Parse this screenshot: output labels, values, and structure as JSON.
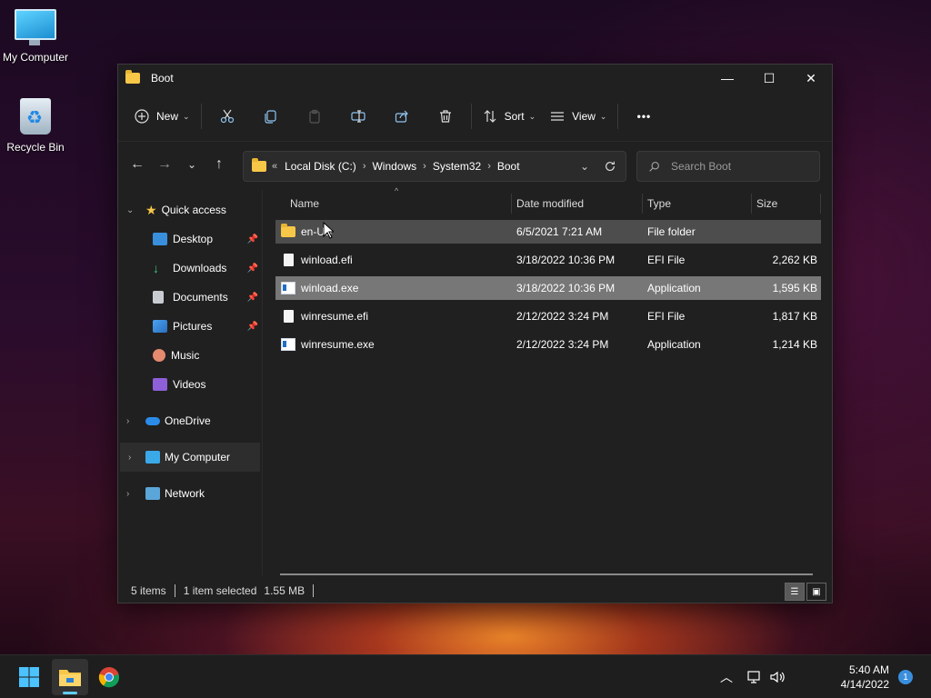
{
  "desktop": {
    "icons": [
      {
        "label": "My Computer",
        "icon": "computer-icon"
      },
      {
        "label": "Recycle Bin",
        "icon": "recycle-bin-icon"
      }
    ]
  },
  "window": {
    "title": "Boot",
    "controls": {
      "minimize": "—",
      "maximize": "☐",
      "close": "✕"
    }
  },
  "toolbar": {
    "new_label": "New",
    "sort_label": "Sort",
    "view_label": "View",
    "more_label": "•••"
  },
  "address": {
    "prefix": "«",
    "crumbs": [
      "Local Disk (C:)",
      "Windows",
      "System32",
      "Boot"
    ]
  },
  "search": {
    "placeholder": "Search Boot"
  },
  "sidebar": {
    "quick_access": "Quick access",
    "items": [
      {
        "label": "Desktop",
        "icon": "desktop-icon",
        "pinned": true
      },
      {
        "label": "Downloads",
        "icon": "downloads-icon",
        "pinned": true
      },
      {
        "label": "Documents",
        "icon": "documents-icon",
        "pinned": true
      },
      {
        "label": "Pictures",
        "icon": "pictures-icon",
        "pinned": true
      },
      {
        "label": "Music",
        "icon": "music-icon",
        "pinned": false
      },
      {
        "label": "Videos",
        "icon": "videos-icon",
        "pinned": false
      }
    ],
    "onedrive": "OneDrive",
    "my_computer": "My Computer",
    "network": "Network"
  },
  "columns": {
    "name": "Name",
    "date": "Date modified",
    "type": "Type",
    "size": "Size"
  },
  "files": [
    {
      "name": "en-US",
      "date": "6/5/2021 7:21 AM",
      "type": "File folder",
      "size": "",
      "kind": "folder"
    },
    {
      "name": "winload.efi",
      "date": "3/18/2022 10:36 PM",
      "type": "EFI File",
      "size": "2,262 KB",
      "kind": "file"
    },
    {
      "name": "winload.exe",
      "date": "3/18/2022 10:36 PM",
      "type": "Application",
      "size": "1,595 KB",
      "kind": "exe"
    },
    {
      "name": "winresume.efi",
      "date": "2/12/2022 3:24 PM",
      "type": "EFI File",
      "size": "1,817 KB",
      "kind": "file"
    },
    {
      "name": "winresume.exe",
      "date": "2/12/2022 3:24 PM",
      "type": "Application",
      "size": "1,214 KB",
      "kind": "exe"
    }
  ],
  "status": {
    "items": "5 items",
    "selection": "1 item selected",
    "size": "1.55 MB"
  },
  "taskbar": {
    "time": "5:40 AM",
    "date": "4/14/2022",
    "notifications": "1"
  },
  "colors": {
    "window_bg": "#202020",
    "selected_row": "#777777",
    "hover_row": "#4d4d4d",
    "folder": "#f7c748",
    "accent": "#3a8fdd"
  }
}
